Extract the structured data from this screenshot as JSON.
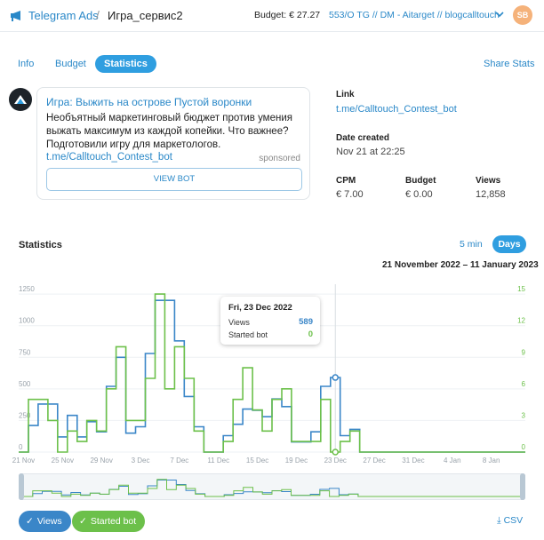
{
  "header": {
    "brand": "Telegram Ads",
    "separator": "/",
    "campaign": "Игра_сервис2",
    "budget": "Budget: € 27.27",
    "account": "553/O TG // DM - Aitarget // blogcalltouch",
    "avatar": "SB"
  },
  "tabs": [
    {
      "label": "Info"
    },
    {
      "label": "Budget"
    },
    {
      "label": "Statistics",
      "active": true
    }
  ],
  "share_label": "Share Stats",
  "ad": {
    "title": "Игра: Выжить на острове Пустой воронки",
    "text": "Необъятный маркетинговый бюджет против умения выжать максимум из каждой копейки. Что важнее? Подготовили игру для маркетологов.",
    "link": "t.me/Calltouch_Contest_bot",
    "sponsored": "sponsored",
    "button": "VIEW BOT"
  },
  "info": {
    "link_label": "Link",
    "link_value": "t.me/Calltouch_Contest_bot",
    "date_label": "Date created",
    "date_value": "Nov 21 at 22:25",
    "cpm_label": "CPM",
    "cpm_value": "€ 7.00",
    "budget_label": "Budget",
    "budget_value": "€ 0.00",
    "views_label": "Views",
    "views_value": "12,858"
  },
  "statistics": {
    "title": "Statistics",
    "zoom_5min": "5 min",
    "zoom_days": "Days",
    "range": "21 November 2022 – 11 January 2023"
  },
  "tooltip": {
    "date": "Fri, 23 Dec 2022",
    "views_label": "Views",
    "views_value": "589",
    "started_label": "Started bot",
    "started_value": "0"
  },
  "legend": {
    "views": "Views",
    "started": "Started bot",
    "csv": "CSV"
  },
  "colors": {
    "views": "#3a86c8",
    "started": "#6cc04a",
    "accent": "#2f9ee0"
  },
  "chart_data": {
    "type": "line",
    "step": true,
    "x_ticks": [
      "21 Nov",
      "25 Nov",
      "29 Nov",
      "3 Dec",
      "7 Dec",
      "11 Dec",
      "15 Dec",
      "19 Dec",
      "23 Dec",
      "27 Dec",
      "31 Dec",
      "4 Jan",
      "8 Jan"
    ],
    "y_left_ticks": [
      "0",
      "250",
      "500",
      "750",
      "1000",
      "1250"
    ],
    "y_right_ticks": [
      "0",
      "3",
      "6",
      "9",
      "12",
      "15"
    ],
    "y_left_lim": [
      0,
      1300
    ],
    "y_right_lim": [
      0,
      15.6
    ],
    "series": [
      {
        "name": "Views",
        "axis": "left",
        "color": "#3a86c8",
        "values": [
          0,
          210,
          380,
          380,
          120,
          290,
          120,
          240,
          160,
          520,
          750,
          150,
          200,
          780,
          1200,
          1200,
          880,
          440,
          200,
          0,
          0,
          130,
          220,
          340,
          330,
          280,
          420,
          360,
          80,
          80,
          160,
          520,
          590,
          130,
          180,
          0,
          0,
          0,
          0,
          0,
          0,
          0,
          0,
          0,
          0,
          0,
          0,
          0,
          0,
          0,
          0,
          0
        ]
      },
      {
        "name": "Started bot",
        "axis": "right",
        "color": "#6cc04a",
        "values": [
          0,
          5,
          5,
          3,
          0,
          2,
          1,
          3,
          2,
          6,
          10,
          3,
          3,
          7,
          15,
          6,
          10,
          7,
          2,
          0,
          0,
          1,
          5,
          8,
          4,
          2,
          5,
          6,
          1,
          1,
          1,
          5,
          0,
          1,
          2,
          0,
          0,
          0,
          0,
          0,
          0,
          0,
          0,
          0,
          0,
          0,
          0,
          0,
          0,
          0,
          0,
          0
        ]
      }
    ],
    "grid": true,
    "highlight": {
      "date": "23 Dec",
      "views": 589,
      "started": 0
    }
  }
}
